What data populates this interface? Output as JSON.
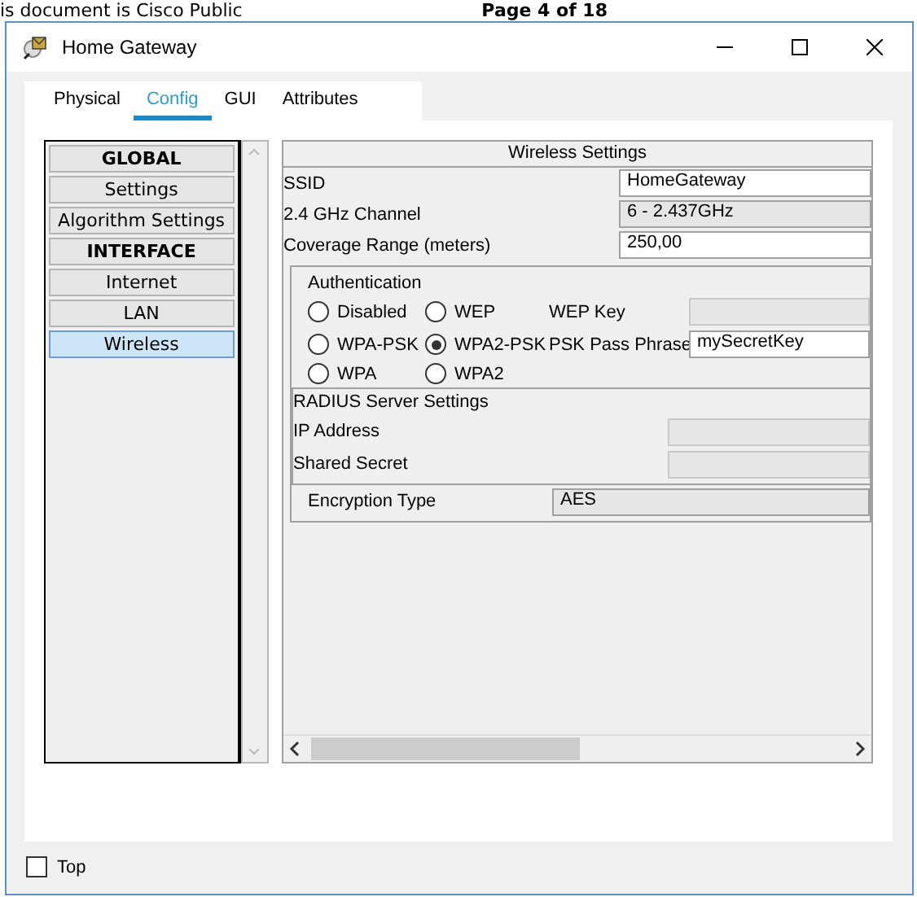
{
  "background": {
    "left_text": "is document is Cisco Public",
    "right_text": "Page 4 of 18"
  },
  "window": {
    "title": "Home Gateway"
  },
  "tabs": [
    {
      "label": "Physical",
      "selected": false
    },
    {
      "label": "Config",
      "selected": true
    },
    {
      "label": "GUI",
      "selected": false
    },
    {
      "label": "Attributes",
      "selected": false
    }
  ],
  "sidebar": {
    "items": [
      {
        "label": "GLOBAL",
        "kind": "header",
        "selected": false
      },
      {
        "label": "Settings",
        "kind": "item",
        "selected": false
      },
      {
        "label": "Algorithm Settings",
        "kind": "item",
        "selected": false
      },
      {
        "label": "INTERFACE",
        "kind": "header",
        "selected": false
      },
      {
        "label": "Internet",
        "kind": "item",
        "selected": false
      },
      {
        "label": "LAN",
        "kind": "item",
        "selected": false
      },
      {
        "label": "Wireless",
        "kind": "item",
        "selected": true
      }
    ]
  },
  "wireless": {
    "title": "Wireless Settings",
    "fields": [
      {
        "label": "SSID",
        "kind": "text",
        "value": "HomeGateway"
      },
      {
        "label": "2.4 GHz Channel",
        "kind": "combo",
        "value": "6 - 2.437GHz"
      },
      {
        "label": "Coverage Range (meters)",
        "kind": "text",
        "value": "250,00"
      }
    ],
    "authentication": {
      "title": "Authentication",
      "options": [
        {
          "label": "Disabled",
          "selected": false
        },
        {
          "label": "WEP",
          "selected": false
        },
        {
          "label": "WPA-PSK",
          "selected": false
        },
        {
          "label": "WPA2-PSK",
          "selected": true
        },
        {
          "label": "WPA",
          "selected": false
        },
        {
          "label": "WPA2",
          "selected": false
        }
      ],
      "wep_key": {
        "label": "WEP Key",
        "disabled": true
      },
      "psk": {
        "label": "PSK Pass Phrase",
        "value": "mySecretKey",
        "disabled": false
      }
    },
    "radius": {
      "title": "RADIUS Server Settings",
      "fields": [
        {
          "label": "IP Address",
          "disabled": true
        },
        {
          "label": "Shared Secret",
          "disabled": true
        }
      ]
    },
    "encryption": {
      "label": "Encryption Type",
      "value": "AES"
    }
  },
  "footer": {
    "top_checkbox": {
      "label": "Top",
      "checked": false
    }
  }
}
